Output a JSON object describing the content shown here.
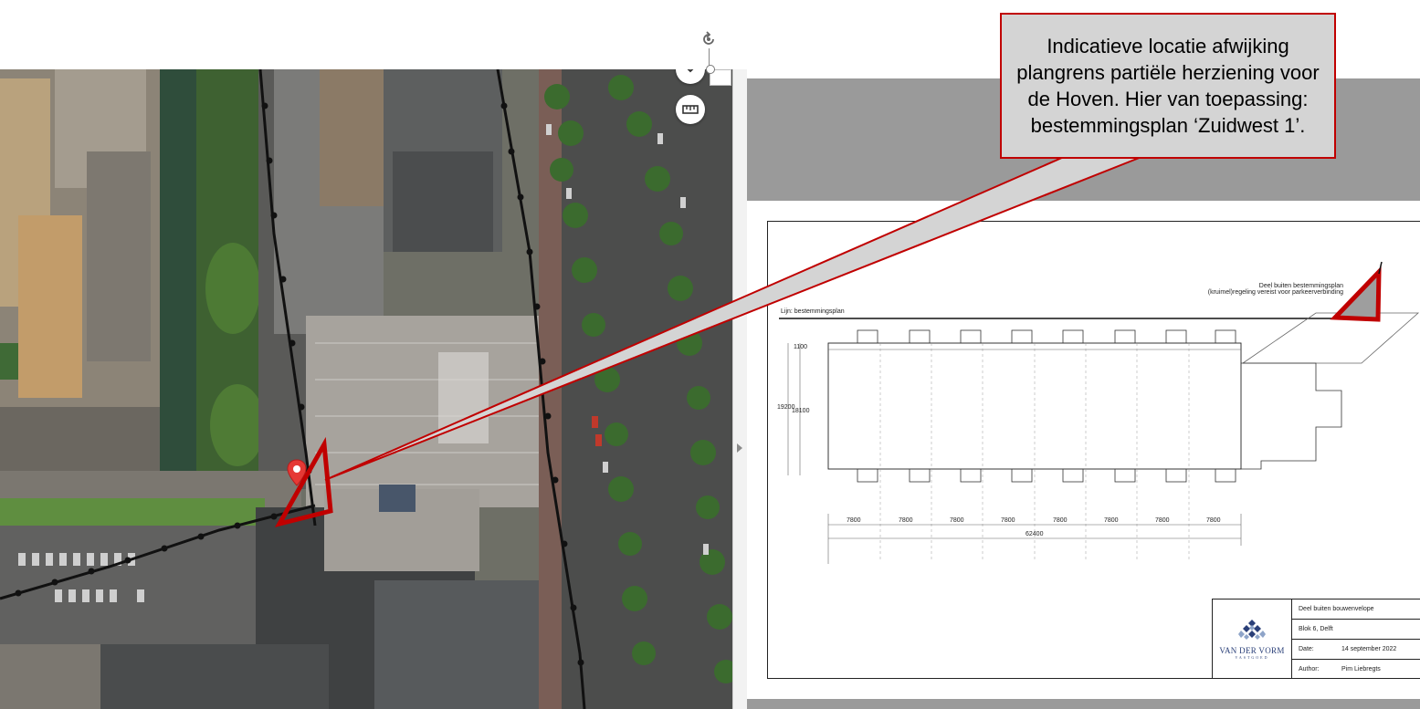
{
  "callout": {
    "text": "Indicatieve locatie afwijking plangrens partiële herziening voor de Hoven. Hier van toepassing: bestemmingsplan ‘Zuidwest 1’.",
    "border_color": "#c00000",
    "fill_color": "#d4d4d4"
  },
  "map": {
    "controls": [
      "chevron-down-icon",
      "ruler-icon"
    ],
    "marker_color": "#e53935"
  },
  "drawing": {
    "outside_label_line1": "Deel buiten bestemmingsplan",
    "outside_label_line2": "(kruimel)regeling vereist voor parkeerverbinding",
    "line_label": "Lijn: bestemmingsplan",
    "dim_top": "1100",
    "dim_height_total": "19200",
    "dim_height_inner": "18100",
    "bay_widths": [
      "7800",
      "7800",
      "7800",
      "7800",
      "7800",
      "7800",
      "7800",
      "7800"
    ],
    "total_width": "62400"
  },
  "titleblock": {
    "company_name": "VAN DER VORM",
    "company_sub": "VASTGOED",
    "title": "Deel buiten bouwenvelope",
    "project": "Blok 6, Delft",
    "date_label": "Date:",
    "date_value": "14 september 2022",
    "author_label": "Author:",
    "author_value": "Pim Liebregts"
  }
}
